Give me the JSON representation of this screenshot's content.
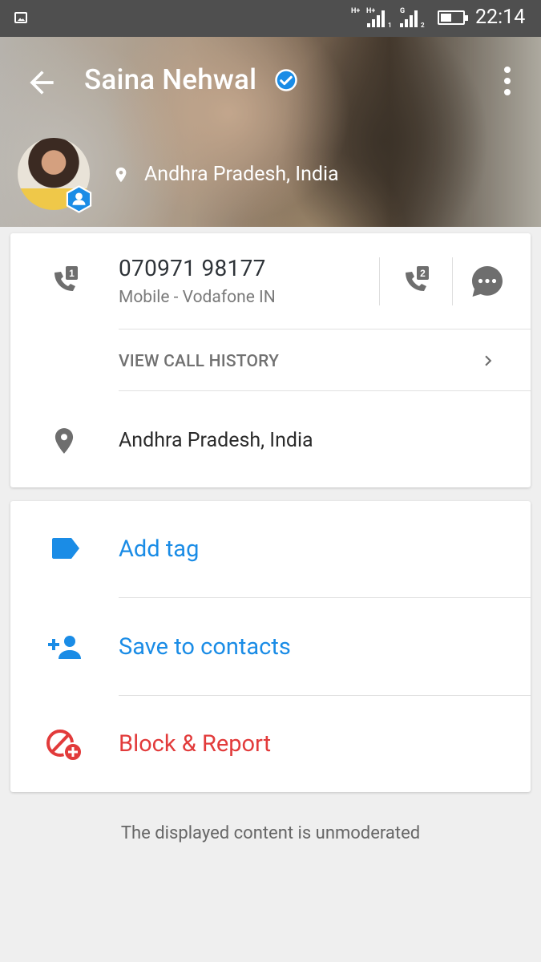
{
  "status_bar": {
    "net1": "H+",
    "net2": "H+",
    "sim1": "1",
    "net3": "G",
    "sim2": "2",
    "time": "22:14"
  },
  "profile": {
    "name": "Saina Nehwal",
    "location": "Andhra Pradesh, India",
    "verified": true
  },
  "phone": {
    "number": "070971 98177",
    "subtitle": "Mobile - Vodafone IN",
    "sim1_label": "1",
    "sim2_label": "2"
  },
  "call_history": {
    "label": "VIEW CALL HISTORY"
  },
  "address": {
    "text": "Andhra Pradesh, India"
  },
  "actions": {
    "add_tag": "Add tag",
    "save_contacts": "Save to contacts",
    "block_report": "Block & Report"
  },
  "footer": {
    "text": "The displayed content is unmoderated"
  },
  "colors": {
    "accent_blue": "#1a8ce6",
    "danger_red": "#e23b3b",
    "icon_gray": "#6e6e6e"
  },
  "icons": [
    "back-arrow-icon",
    "verified-icon",
    "more-vert-icon",
    "location-pin-icon",
    "sim1-call-icon",
    "sim2-call-icon",
    "message-icon",
    "chevron-right-icon",
    "tag-icon",
    "person-add-icon",
    "block-icon",
    "profile-badge-icon"
  ]
}
